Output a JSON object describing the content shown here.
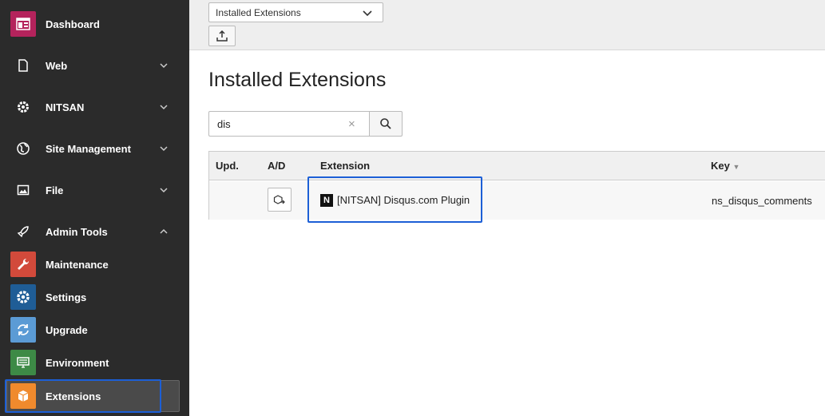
{
  "sidebar": {
    "items": [
      {
        "label": "Dashboard",
        "icon": "dashboard-icon",
        "color": "#b4235c"
      },
      {
        "label": "Web",
        "icon": "page-icon"
      },
      {
        "label": "NITSAN",
        "icon": "gear-icon"
      },
      {
        "label": "Site Management",
        "icon": "globe-icon"
      },
      {
        "label": "File",
        "icon": "image-icon"
      },
      {
        "label": "Admin Tools",
        "icon": "rocket-icon"
      },
      {
        "label": "Maintenance",
        "icon": "wrench-icon",
        "color": "#d24a3b"
      },
      {
        "label": "Settings",
        "icon": "gear-icon",
        "color": "#1f5d96"
      },
      {
        "label": "Upgrade",
        "icon": "refresh-icon",
        "color": "#5b9bd5"
      },
      {
        "label": "Environment",
        "icon": "monitor-icon",
        "color": "#3d8a46"
      },
      {
        "label": "Extensions",
        "icon": "box-icon",
        "color": "#f08a2d"
      }
    ]
  },
  "toolbar": {
    "select_value": "Installed Extensions",
    "upload_icon": "upload-icon"
  },
  "main": {
    "title": "Installed Extensions",
    "search": {
      "value": "dis",
      "clear": "×"
    },
    "table": {
      "headers": [
        "Upd.",
        "A/D",
        "Extension",
        "Key"
      ],
      "rows": [
        {
          "extension": "[NITSAN] Disqus.com Plugin",
          "extension_icon_letter": "N",
          "key": "ns_disqus_comments"
        }
      ]
    }
  }
}
